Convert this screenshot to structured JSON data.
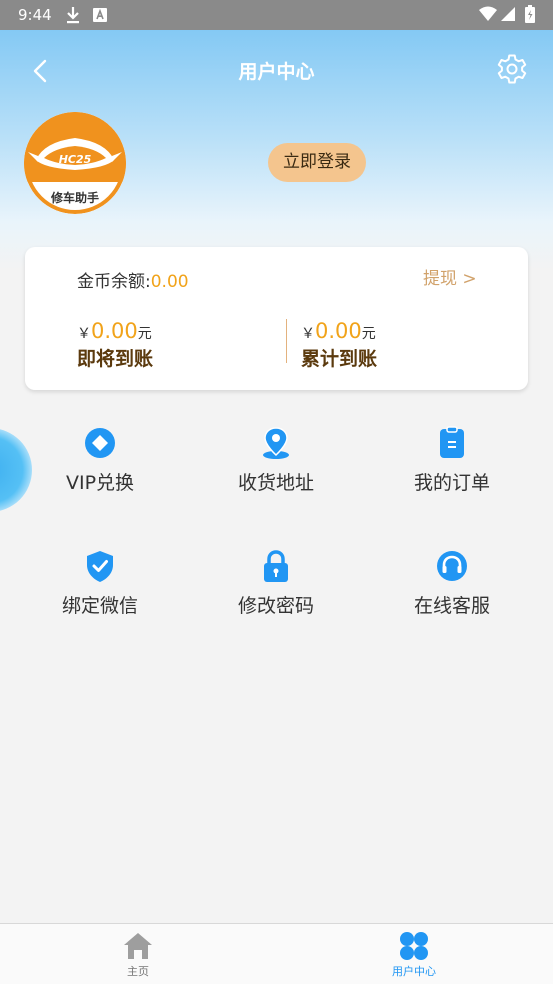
{
  "status_bar": {
    "time": "9:44"
  },
  "header": {
    "title": "用户中心"
  },
  "profile": {
    "logo_brand": "HC25",
    "logo_text": "修车助手",
    "login_label": "立即登录"
  },
  "wallet": {
    "balance_label": "金币余额:",
    "balance_value": "0.00",
    "withdraw_label": "提现 >",
    "pending": {
      "currency": "￥",
      "amount": "0.00",
      "unit": "元",
      "label": "即将到账"
    },
    "total": {
      "currency": "￥",
      "amount": "0.00",
      "unit": "元",
      "label": "累计到账"
    }
  },
  "menu": [
    {
      "label": "VIP兑换",
      "icon": "vip-icon"
    },
    {
      "label": "收货地址",
      "icon": "location-pin-icon"
    },
    {
      "label": "我的订单",
      "icon": "order-clipboard-icon"
    },
    {
      "label": "绑定微信",
      "icon": "shield-check-icon"
    },
    {
      "label": "修改密码",
      "icon": "lock-icon"
    },
    {
      "label": "在线客服",
      "icon": "headset-icon"
    }
  ],
  "bottom_nav": [
    {
      "label": "主页",
      "icon": "home-icon",
      "active": false
    },
    {
      "label": "用户中心",
      "icon": "grid-icon",
      "active": true
    }
  ],
  "colors": {
    "accent_blue": "#2196f3",
    "gold": "#f1a31a",
    "login_button": "#f4c58e",
    "nav_inactive": "#777777",
    "header_gradient_top": "#84c9f4"
  }
}
